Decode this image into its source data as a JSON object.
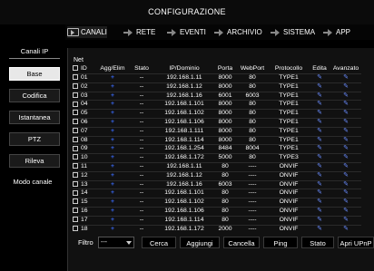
{
  "title": "CONFIGURAZIONE",
  "tabs": [
    {
      "label": "CANALI",
      "active": true
    },
    {
      "label": "RETE",
      "active": false
    },
    {
      "label": "EVENTI",
      "active": false
    },
    {
      "label": "ARCHIVIO",
      "active": false
    },
    {
      "label": "SISTEMA",
      "active": false
    },
    {
      "label": "APP",
      "active": false
    }
  ],
  "sidebar": {
    "items": [
      {
        "label": "Canali IP",
        "type": "link"
      },
      {
        "label": "Base",
        "type": "button",
        "active": true
      },
      {
        "label": "Codifica",
        "type": "button"
      },
      {
        "label": "Istantanea",
        "type": "button"
      },
      {
        "label": "PTZ",
        "type": "button"
      },
      {
        "label": "Rileva",
        "type": "button"
      },
      {
        "label": "Modo canale",
        "type": "button"
      }
    ]
  },
  "net_label": "Net",
  "table": {
    "columns": [
      "ID",
      "Agg/Elim",
      "Stato",
      "IP/Dominio",
      "Porta",
      "WebPort",
      "Protocollo",
      "Edita",
      "Avanzato"
    ],
    "rows": [
      {
        "id": "01",
        "add": "+",
        "state": "--",
        "ip": "192.168.1.11",
        "port": "8000",
        "web": "80",
        "proto": "TYPE1",
        "edit": "✎",
        "adv": "✎"
      },
      {
        "id": "02",
        "add": "+",
        "state": "--",
        "ip": "192.168.1.12",
        "port": "8000",
        "web": "80",
        "proto": "TYPE1",
        "edit": "✎",
        "adv": "✎"
      },
      {
        "id": "03",
        "add": "+",
        "state": "--",
        "ip": "192.168.1.16",
        "port": "6001",
        "web": "6003",
        "proto": "TYPE1",
        "edit": "✎",
        "adv": "✎"
      },
      {
        "id": "04",
        "add": "+",
        "state": "--",
        "ip": "192.168.1.101",
        "port": "8000",
        "web": "80",
        "proto": "TYPE1",
        "edit": "✎",
        "adv": "✎"
      },
      {
        "id": "05",
        "add": "+",
        "state": "--",
        "ip": "192.168.1.102",
        "port": "8000",
        "web": "80",
        "proto": "TYPE1",
        "edit": "✎",
        "adv": "✎"
      },
      {
        "id": "06",
        "add": "+",
        "state": "--",
        "ip": "192.168.1.106",
        "port": "8000",
        "web": "80",
        "proto": "TYPE1",
        "edit": "✎",
        "adv": "✎"
      },
      {
        "id": "07",
        "add": "+",
        "state": "--",
        "ip": "192.168.1.111",
        "port": "8000",
        "web": "80",
        "proto": "TYPE1",
        "edit": "✎",
        "adv": "✎"
      },
      {
        "id": "08",
        "add": "+",
        "state": "--",
        "ip": "192.168.1.114",
        "port": "8000",
        "web": "80",
        "proto": "TYPE1",
        "edit": "✎",
        "adv": "✎"
      },
      {
        "id": "09",
        "add": "+",
        "state": "--",
        "ip": "192.168.1.254",
        "port": "8484",
        "web": "8004",
        "proto": "TYPE1",
        "edit": "✎",
        "adv": "✎"
      },
      {
        "id": "10",
        "add": "+",
        "state": "--",
        "ip": "192.168.1.172",
        "port": "5000",
        "web": "80",
        "proto": "TYPE3",
        "edit": "✎",
        "adv": "✎"
      },
      {
        "id": "11",
        "add": "+",
        "state": "--",
        "ip": "192.168.1.11",
        "port": "80",
        "web": "----",
        "proto": "ONVIF",
        "edit": "✎",
        "adv": "✎"
      },
      {
        "id": "12",
        "add": "+",
        "state": "--",
        "ip": "192.168.1.12",
        "port": "80",
        "web": "----",
        "proto": "ONVIF",
        "edit": "✎",
        "adv": "✎"
      },
      {
        "id": "13",
        "add": "+",
        "state": "--",
        "ip": "192.168.1.16",
        "port": "6003",
        "web": "----",
        "proto": "ONVIF",
        "edit": "✎",
        "adv": "✎"
      },
      {
        "id": "14",
        "add": "+",
        "state": "--",
        "ip": "192.168.1.101",
        "port": "80",
        "web": "----",
        "proto": "ONVIF",
        "edit": "✎",
        "adv": "✎"
      },
      {
        "id": "15",
        "add": "+",
        "state": "--",
        "ip": "192.168.1.102",
        "port": "80",
        "web": "----",
        "proto": "ONVIF",
        "edit": "✎",
        "adv": "✎"
      },
      {
        "id": "16",
        "add": "+",
        "state": "--",
        "ip": "192.168.1.106",
        "port": "80",
        "web": "----",
        "proto": "ONVIF",
        "edit": "✎",
        "adv": "✎"
      },
      {
        "id": "17",
        "add": "+",
        "state": "--",
        "ip": "192.168.1.114",
        "port": "80",
        "web": "----",
        "proto": "ONVIF",
        "edit": "✎",
        "adv": "✎"
      },
      {
        "id": "18",
        "add": "+",
        "state": "--",
        "ip": "192.168.1.172",
        "port": "2000",
        "web": "----",
        "proto": "ONVIF",
        "edit": "✎",
        "adv": "✎"
      }
    ]
  },
  "bottom": {
    "filter_label": "Filtro",
    "filter_value": "---",
    "buttons": [
      "Cerca",
      "Aggiungi",
      "Cancella",
      "Ping",
      "Stato",
      "Apri UPnP"
    ]
  },
  "colors": {
    "accent": "#3b6cff",
    "background": "#000000"
  }
}
